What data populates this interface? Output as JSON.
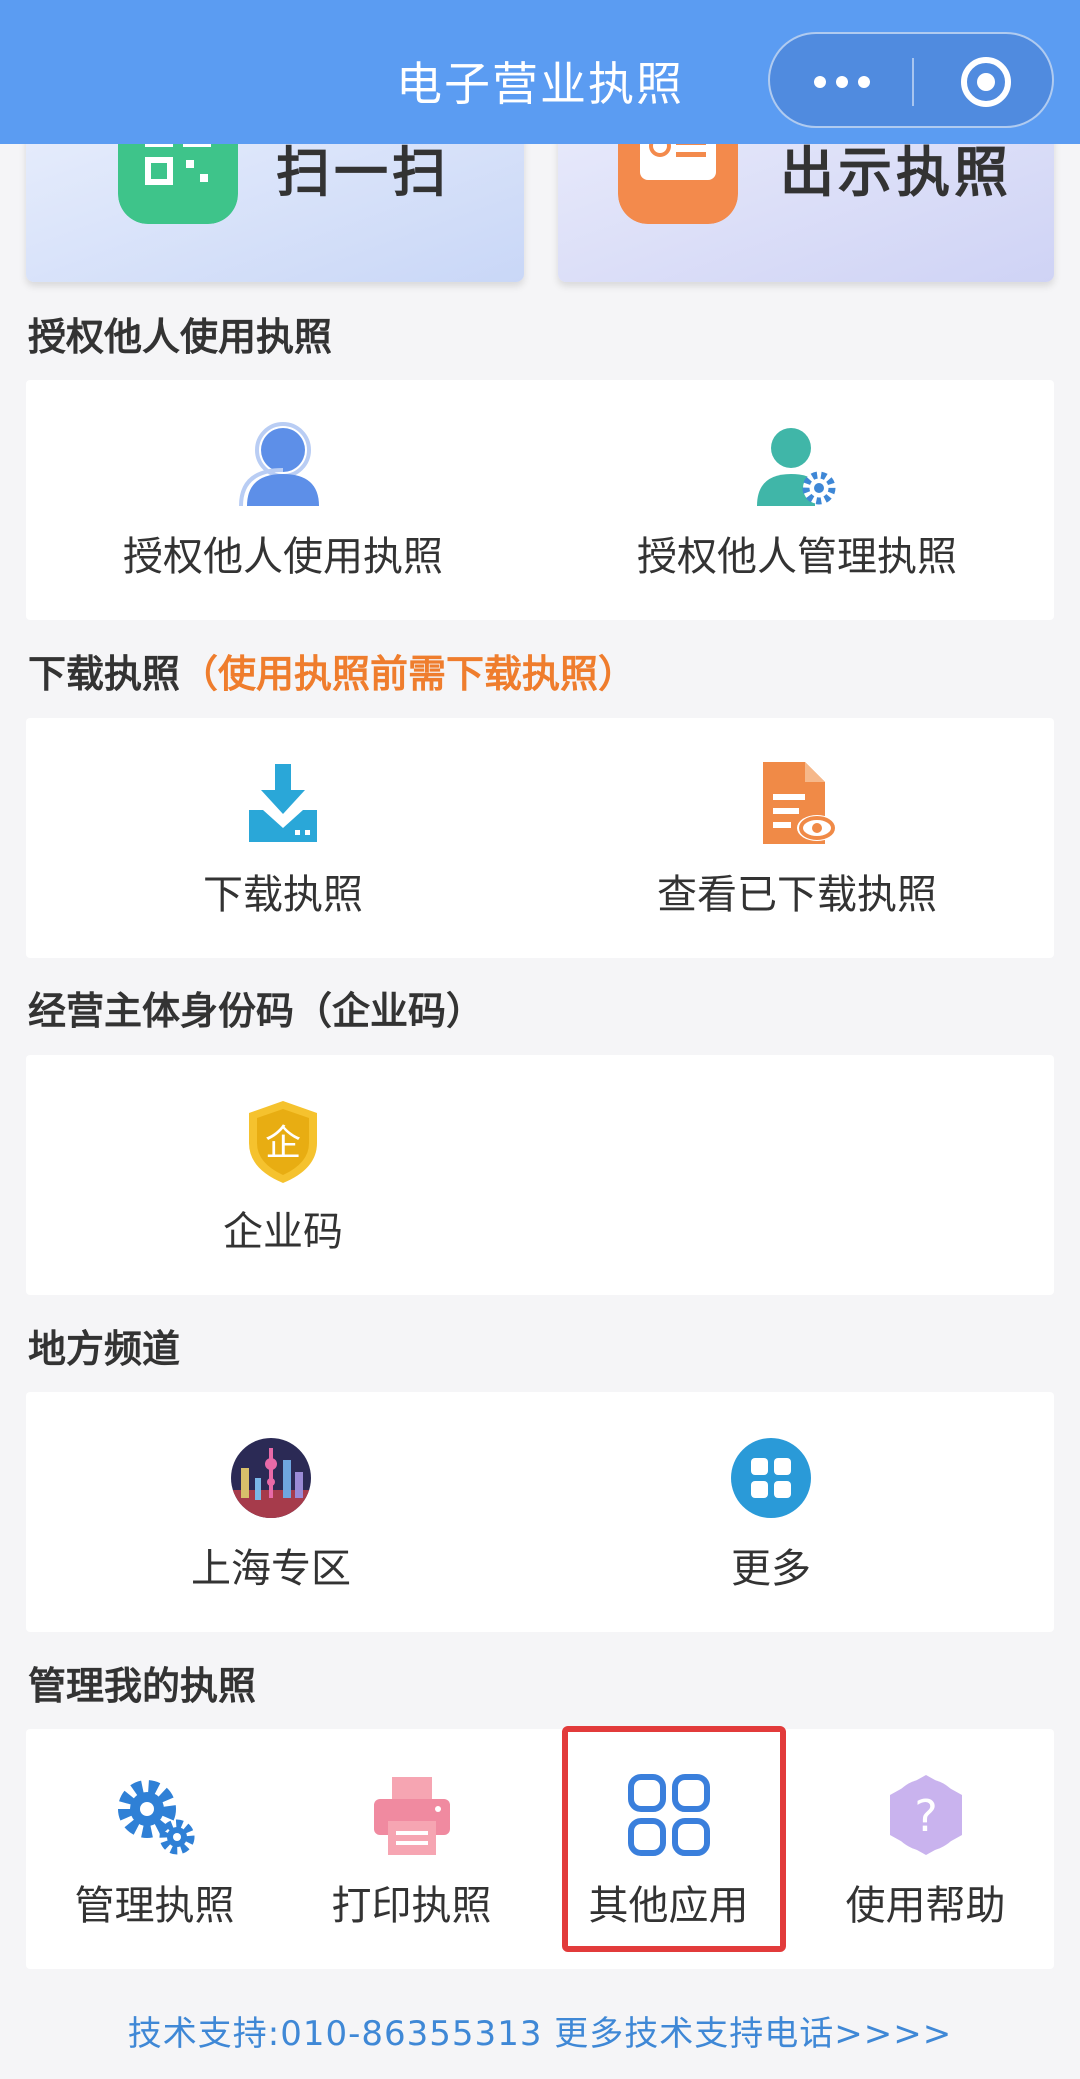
{
  "header": {
    "title": "电子营业执照",
    "menu_icon": "more-dots-icon",
    "close_icon": "close-ring-icon",
    "bg_color": "#5b9cf2"
  },
  "top_cards": [
    {
      "label": "扫一扫",
      "icon": "qr-scan-icon",
      "color": "#3ec48a"
    },
    {
      "label": "出示执照",
      "icon": "license-card-icon",
      "color": "#f38a4c"
    }
  ],
  "sections": {
    "authorize": {
      "title": "授权他人使用执照",
      "items": [
        {
          "label": "授权他人使用执照",
          "icon": "user-icon"
        },
        {
          "label": "授权他人管理执照",
          "icon": "user-gear-icon"
        }
      ]
    },
    "download": {
      "title": "下载执照",
      "hint": "（使用执照前需下载执照）",
      "items": [
        {
          "label": "下载执照",
          "icon": "download-icon"
        },
        {
          "label": "查看已下载执照",
          "icon": "document-view-icon"
        }
      ]
    },
    "identity": {
      "title": "经营主体身份码（企业码）",
      "items": [
        {
          "label": "企业码",
          "icon": "enterprise-shield-icon",
          "glyph": "企"
        }
      ]
    },
    "local": {
      "title": "地方频道",
      "items": [
        {
          "label": "上海专区",
          "icon": "shanghai-skyline-icon"
        },
        {
          "label": "更多",
          "icon": "grid-more-icon"
        }
      ]
    },
    "manage": {
      "title": "管理我的执照",
      "items": [
        {
          "label": "管理执照",
          "icon": "gears-icon"
        },
        {
          "label": "打印执照",
          "icon": "printer-icon"
        },
        {
          "label": "其他应用",
          "icon": "apps-grid-icon"
        },
        {
          "label": "使用帮助",
          "icon": "help-icon",
          "glyph": "?"
        }
      ]
    }
  },
  "footer": {
    "text": "技术支持:010-86355313  更多技术支持电话>>>>"
  }
}
